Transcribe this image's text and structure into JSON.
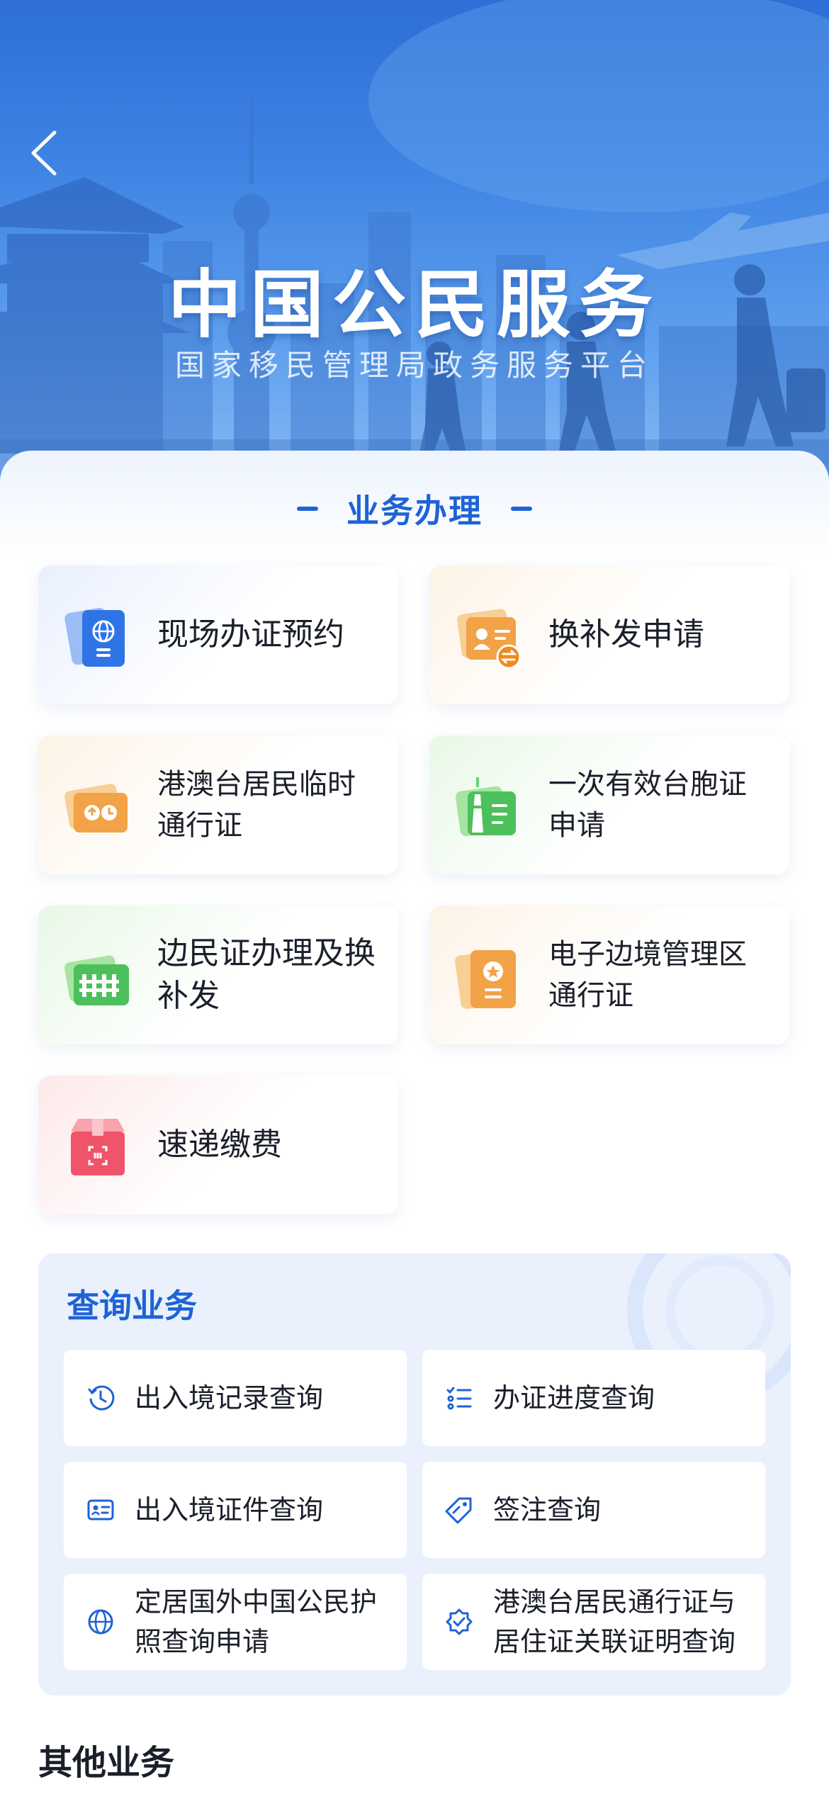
{
  "hero": {
    "title": "中国公民服务",
    "subtitle": "国家移民管理局政务服务平台"
  },
  "business": {
    "heading": "业务办理",
    "cards": [
      {
        "label": "现场办证预约",
        "icon": "passport-globe-icon",
        "theme": "blue"
      },
      {
        "label": "换补发申请",
        "icon": "id-card-exchange-icon",
        "theme": "orange"
      },
      {
        "label": "港澳台居民临时通行证",
        "icon": "travel-permit-icon",
        "theme": "orange"
      },
      {
        "label": "一次有效台胞证申请",
        "icon": "tower-document-icon",
        "theme": "green"
      },
      {
        "label": "边民证办理及换补发",
        "icon": "border-fence-card-icon",
        "theme": "green"
      },
      {
        "label": "电子边境管理区通行证",
        "icon": "star-badge-document-icon",
        "theme": "orange"
      },
      {
        "label": "速递缴费",
        "icon": "parcel-scan-icon",
        "theme": "red"
      }
    ]
  },
  "query": {
    "title": "查询业务",
    "items": [
      {
        "label": "出入境记录查询",
        "icon": "history-clock-icon"
      },
      {
        "label": "办证进度查询",
        "icon": "checklist-icon"
      },
      {
        "label": "出入境证件查询",
        "icon": "id-card-icon"
      },
      {
        "label": "签注查询",
        "icon": "tag-edit-icon"
      },
      {
        "label": "定居国外中国公民护照查询申请",
        "icon": "globe-icon"
      },
      {
        "label": "港澳台居民通行证与居住证关联证明查询",
        "icon": "verified-badge-icon"
      }
    ]
  },
  "other": {
    "title": "其他业务"
  },
  "colors": {
    "accent": "#1e63d6",
    "hero_top": "#2d6fd6",
    "panel": "#eaf1fd"
  }
}
